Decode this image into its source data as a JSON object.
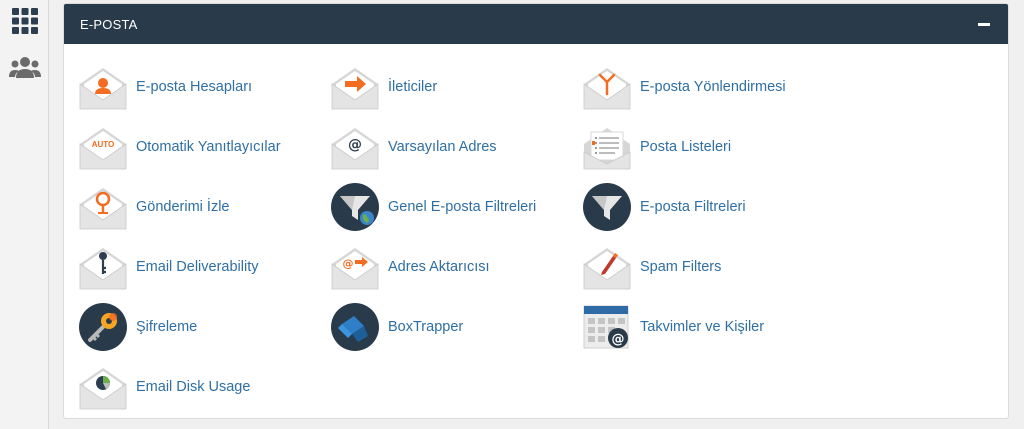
{
  "sidebar": {
    "items": [
      {
        "name": "apps-grid-icon"
      },
      {
        "name": "users-group-icon"
      }
    ]
  },
  "panel": {
    "title": "E-POSTA",
    "items": [
      {
        "label": "E-posta Hesapları",
        "icon": "envelope-person-icon"
      },
      {
        "label": "İleticiler",
        "icon": "envelope-forward-icon"
      },
      {
        "label": "E-posta Yönlendirmesi",
        "icon": "envelope-routing-icon"
      },
      {
        "label": "Otomatik Yanıtlayıcılar",
        "icon": "envelope-auto-icon"
      },
      {
        "label": "Varsayılan Adres",
        "icon": "envelope-at-icon"
      },
      {
        "label": "Posta Listeleri",
        "icon": "envelope-list-icon"
      },
      {
        "label": "Gönderimi İzle",
        "icon": "envelope-pin-icon"
      },
      {
        "label": "Genel E-posta Filtreleri",
        "icon": "funnel-globe-icon"
      },
      {
        "label": "E-posta Filtreleri",
        "icon": "funnel-icon"
      },
      {
        "label": "Email Deliverability",
        "icon": "envelope-key-icon"
      },
      {
        "label": "Adres Aktarıcısı",
        "icon": "envelope-import-icon"
      },
      {
        "label": "Spam Filters",
        "icon": "envelope-pen-icon"
      },
      {
        "label": "Şifreleme",
        "icon": "encryption-key-icon"
      },
      {
        "label": "BoxTrapper",
        "icon": "boxtrapper-icon"
      },
      {
        "label": "Takvimler ve Kişiler",
        "icon": "calendar-at-icon"
      },
      {
        "label": "Email Disk Usage",
        "icon": "envelope-pie-icon"
      }
    ]
  },
  "colors": {
    "header_bg": "#293a4a",
    "link": "#2f6fa3",
    "accent": "#f26d21"
  }
}
